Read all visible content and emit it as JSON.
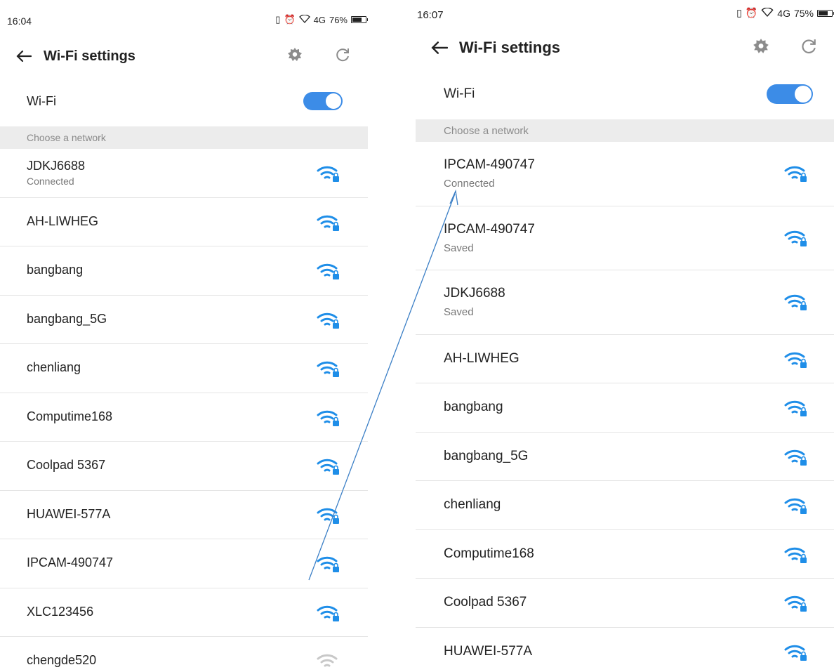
{
  "left": {
    "status": {
      "time": "16:04",
      "signal": "4G",
      "battery": "76%",
      "battery_level": 0.76
    },
    "toolbar": {
      "title": "Wi-Fi settings"
    },
    "wifi": {
      "label": "Wi-Fi",
      "enabled": true
    },
    "section": "Choose a network",
    "networks": [
      {
        "name": "JDKJ6688",
        "status": "Connected"
      },
      {
        "name": "AH-LIWHEG"
      },
      {
        "name": "bangbang"
      },
      {
        "name": "bangbang_5G"
      },
      {
        "name": "chenliang"
      },
      {
        "name": "Computime168"
      },
      {
        "name": "Coolpad 5367"
      },
      {
        "name": "HUAWEI-577A"
      },
      {
        "name": "IPCAM-490747"
      },
      {
        "name": "XLC123456"
      },
      {
        "name": "chengde520"
      }
    ]
  },
  "right": {
    "status": {
      "time": "16:07",
      "signal": "4G",
      "battery": "75%",
      "battery_level": 0.75
    },
    "toolbar": {
      "title": "Wi-Fi settings"
    },
    "wifi": {
      "label": "Wi-Fi",
      "enabled": true
    },
    "section": "Choose a network",
    "networks": [
      {
        "name": "IPCAM-490747",
        "status": "Connected"
      },
      {
        "name": "IPCAM-490747",
        "status": "Saved"
      },
      {
        "name": "JDKJ6688",
        "status": "Saved"
      },
      {
        "name": "AH-LIWHEG"
      },
      {
        "name": "bangbang"
      },
      {
        "name": "bangbang_5G"
      },
      {
        "name": "chenliang"
      },
      {
        "name": "Computime168"
      },
      {
        "name": "Coolpad 5367"
      },
      {
        "name": "HUAWEI-577A"
      }
    ]
  },
  "colors": {
    "accent": "#3c8ce7",
    "wifi_icon": "#1f8ee8",
    "lock": "#1f8ee8",
    "arrow": "#3b7fc6"
  },
  "icons": [
    "back-arrow-icon",
    "gear-icon",
    "refresh-icon",
    "wifi-lock-icon",
    "battery-icon"
  ]
}
